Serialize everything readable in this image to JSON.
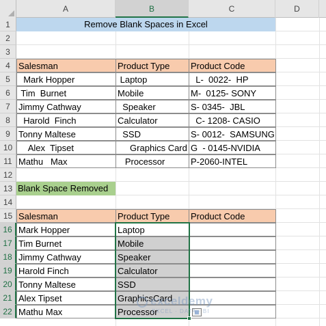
{
  "columns": [
    "A",
    "B",
    "C",
    "D"
  ],
  "rows": [
    "1",
    "2",
    "3",
    "4",
    "5",
    "6",
    "7",
    "8",
    "9",
    "10",
    "11",
    "12",
    "13",
    "14",
    "15",
    "16",
    "17",
    "18",
    "19",
    "20",
    "21",
    "22"
  ],
  "title": "Remove Blank Spaces in Excel",
  "table1": {
    "headers": [
      "Salesman",
      "Product Type",
      "Product Code"
    ],
    "rows": [
      [
        "  Mark Hopper",
        " Laptop",
        "  L-  0022-  HP"
      ],
      [
        " Tim  Burnet",
        "Mobile",
        "M-  0125- SONY"
      ],
      [
        "Jimmy Cathway",
        "  Speaker",
        "S- 0345-  JBL"
      ],
      [
        "  Harold  Finch",
        "Calculator",
        "  C- 1208- CASIO"
      ],
      [
        "Tonny Maltese",
        "  SSD",
        "S- 0012-  SAMSUNG"
      ],
      [
        "    Alex  Tipset",
        "     Graphics Card",
        "G  - 0145-NVIDIA"
      ],
      [
        "Mathu   Max",
        "   Processor",
        "P-2060-INTEL"
      ]
    ]
  },
  "section_label": "Blank Space Removed",
  "table2": {
    "headers": [
      "Salesman",
      "Product Type",
      "Product Code"
    ],
    "rows": [
      [
        "Mark Hopper",
        "Laptop",
        ""
      ],
      [
        "Tim Burnet",
        "Mobile",
        ""
      ],
      [
        "Jimmy Cathway",
        "Speaker",
        ""
      ],
      [
        "Harold Finch",
        "Calculator",
        ""
      ],
      [
        "Tonny Maltese",
        "SSD",
        ""
      ],
      [
        "Alex Tipset",
        "GraphicsCard",
        ""
      ],
      [
        "Mathu Max",
        "Processor",
        ""
      ]
    ]
  },
  "watermark": {
    "brand": "exceldemy",
    "tagline": "EXCEL · DATA · BI"
  },
  "colors": {
    "title_fill": "#bdd7ee",
    "header_fill": "#f8cbad",
    "label_fill": "#a9d08e",
    "selection": "#217346",
    "selected_fill": "#d0d0d0"
  },
  "selection": {
    "range": "B16:B22",
    "column": "B"
  },
  "icons": [
    "paste-options-icon",
    "select-all-corner-icon"
  ]
}
